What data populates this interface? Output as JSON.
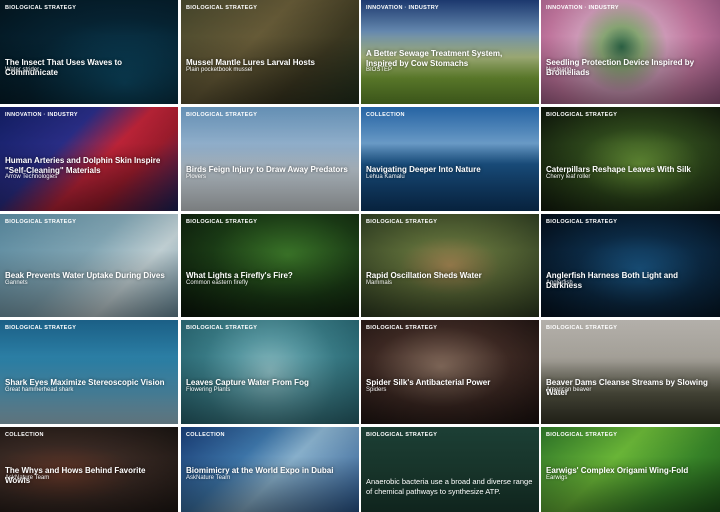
{
  "cards": [
    {
      "category": "Biological Strategy",
      "title": "The Insect That Uses Waves to Communicate",
      "subtitle": "Water strider"
    },
    {
      "category": "Biological Strategy",
      "title": "Mussel Mantle Lures Larval Hosts",
      "subtitle": "Plain pocketbook mussel"
    },
    {
      "category": "Innovation · Industry",
      "title": "A Better Sewage Treatment System, Inspired by Cow Stomachs",
      "subtitle": "BIOSTEP"
    },
    {
      "category": "Innovation · Industry",
      "title": "Seedling Protection Device Inspired by Bromeliads",
      "subtitle": "Nucleario"
    },
    {
      "category": "Innovation · Industry",
      "title": "Human Arteries and Dolphin Skin Inspire \"Self-Cleaning\" Materials",
      "subtitle": "Arrow Technologies"
    },
    {
      "category": "Biological Strategy",
      "title": "Birds Feign Injury to Draw Away Predators",
      "subtitle": "Plovers"
    },
    {
      "category": "Collection",
      "title": "Navigating Deeper Into Nature",
      "subtitle": "Lehua Kamalu"
    },
    {
      "category": "Biological Strategy",
      "title": "Caterpillars Reshape Leaves With Silk",
      "subtitle": "Cherry leaf roller"
    },
    {
      "category": "Biological Strategy",
      "title": "Beak Prevents Water Uptake During Dives",
      "subtitle": "Gannets"
    },
    {
      "category": "Biological Strategy",
      "title": "What Lights a Firefly's Fire?",
      "subtitle": "Common eastern firefly"
    },
    {
      "category": "Biological Strategy",
      "title": "Rapid Oscillation Sheds Water",
      "subtitle": "Mammals"
    },
    {
      "category": "Biological Strategy",
      "title": "Anglerfish Harness Both Light and Darkness",
      "subtitle": "Anglerfish"
    },
    {
      "category": "Biological Strategy",
      "title": "Shark Eyes Maximize Stereoscopic Vision",
      "subtitle": "Great hammerhead shark"
    },
    {
      "category": "Biological Strategy",
      "title": "Leaves Capture Water From Fog",
      "subtitle": "Flowering Plants"
    },
    {
      "category": "Biological Strategy",
      "title": "Spider Silk's Antibacterial Power",
      "subtitle": "Spiders"
    },
    {
      "category": "Biological Strategy",
      "title": "Beaver Dams Cleanse Streams by Slowing Water",
      "subtitle": "American beaver"
    },
    {
      "category": "Collection",
      "title": "The Whys and Hows Behind Favorite Wowls",
      "subtitle": "AskNature Team"
    },
    {
      "category": "Collection",
      "title": "Biomimicry at the World Expo in Dubai",
      "subtitle": "AskNature Team"
    },
    {
      "category": "Biological Strategy",
      "title": "Anaerobic bacteria use a broad and diverse range of chemical pathways to synthesize ATP.",
      "subtitle": ""
    },
    {
      "category": "Biological Strategy",
      "title": "Earwigs' Complex Origami Wing-Fold",
      "subtitle": "Earwigs"
    }
  ]
}
